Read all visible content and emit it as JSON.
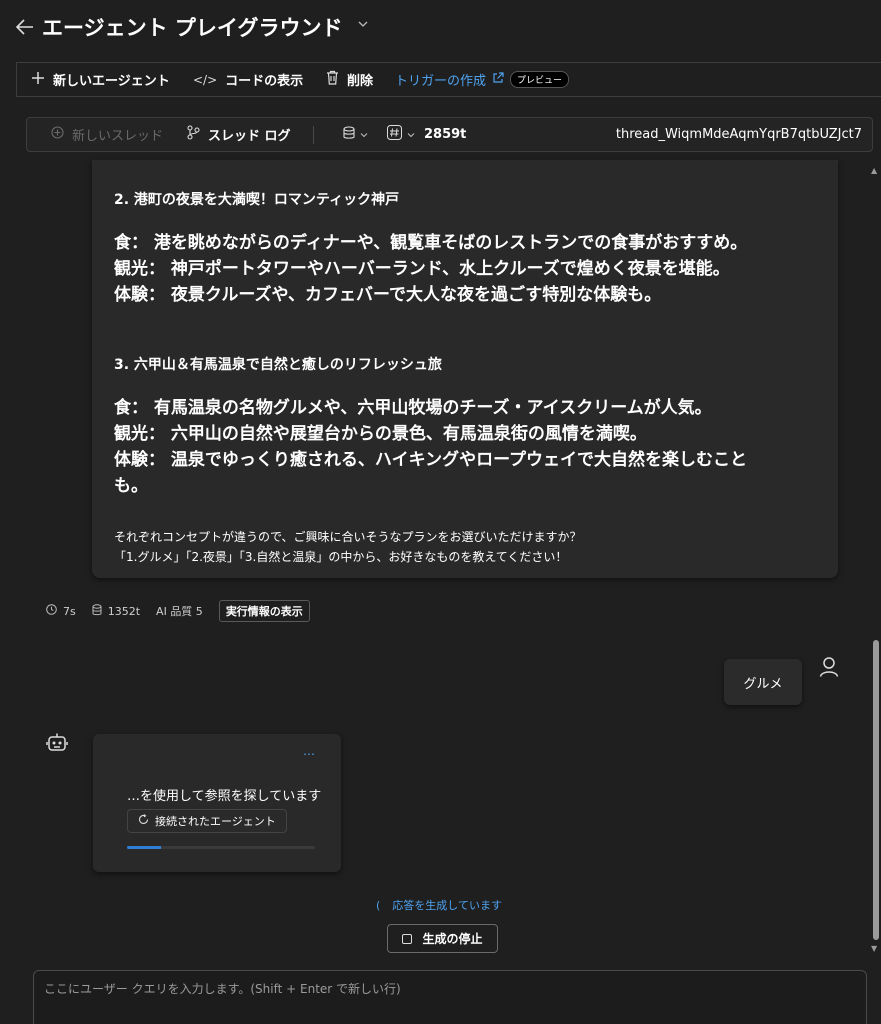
{
  "header": {
    "title": "エージェント プレイグラウンド",
    "back_icon": "arrow-left-icon",
    "chevron_icon": "chevron-down-icon"
  },
  "toolbar": {
    "new_agent": "新しいエージェント",
    "view_code": "コードの表示",
    "delete": "削除",
    "create_trigger": "トリガーの作成",
    "preview_badge": "プレビュー"
  },
  "thread_bar": {
    "new_thread": "新しいスレッド",
    "thread_log": "スレッド ログ",
    "token_count": "2859t",
    "thread_id": "thread_WiqmMdeAqmYqrB7qtbUZJct7"
  },
  "assistant_message": {
    "section2_title": "2. 港町の夜景を大満喫！ロマンティック神戸",
    "section2_lines": [
      "食： 港を眺めながらのディナーや、観覧車そばのレストランでの食事がおすすめ。",
      "観光： 神戸ポートタワーやハーバーランド、水上クルーズで煌めく夜景を堪能。",
      "体験： 夜景クルーズや、カフェバーで大人な夜を過ごす特別な体験も。"
    ],
    "section3_title": "3. 六甲山＆有馬温泉で自然と癒しのリフレッシュ旅",
    "section3_lines": [
      "食： 有馬温泉の名物グルメや、六甲山牧場のチーズ・アイスクリームが人気。",
      "観光： 六甲山の自然や展望台からの景色、有馬温泉街の風情を満喫。",
      "体験： 温泉でゆっくり癒される、ハイキングやロープウェイで大自然を楽しむこと",
      "も。"
    ],
    "closing_lines": [
      "それぞれコンセプトが違うので、ご興味に合いそうなプランをお選びいただけますか？",
      "「1.グルメ」「2.夜景」「3.自然と温泉」の中から、お好きなものを教えてください！"
    ]
  },
  "stats": {
    "duration": "7s",
    "tokens": "1352t",
    "ai_quality": "AI 品質 5",
    "run_info_button": "実行情報の表示"
  },
  "user_message": {
    "text": "グルメ"
  },
  "agent_thinking": {
    "dots": "…",
    "status_text": "…を使用して参照を探しています",
    "chip_label": "接続されたエージェント",
    "progress": 0.18
  },
  "generation": {
    "status_text": "応答を生成しています",
    "stop_button": "生成の停止"
  },
  "input": {
    "placeholder": "ここにユーザー クエリを入力します。(Shift + Enter で新しい行)",
    "value": ""
  },
  "colors": {
    "background": "#1f1f1f",
    "card": "#292929",
    "accent": "#4ea3f1",
    "progress": "#2f7fd6"
  }
}
